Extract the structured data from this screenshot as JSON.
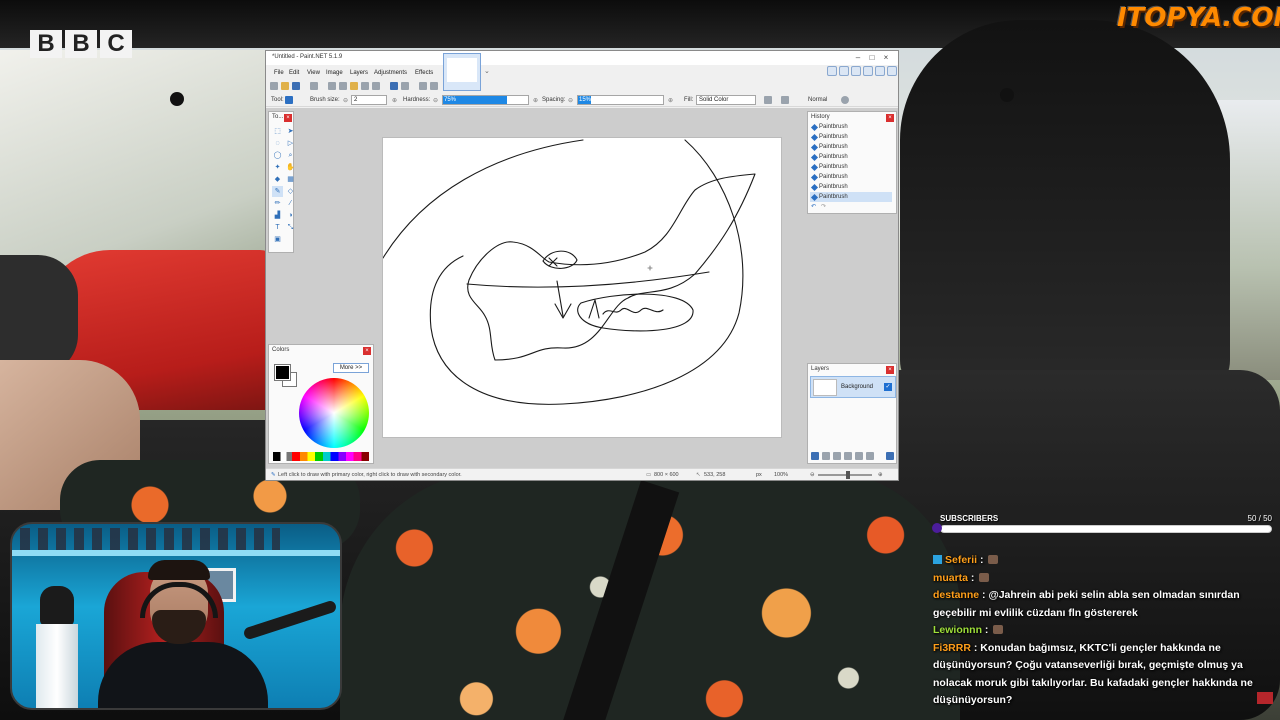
{
  "overlay": {
    "bbc_logo_letters": [
      "B",
      "B",
      "C"
    ],
    "site_logo": "ITOPYA.COM"
  },
  "paint": {
    "title": "*Untitled - Paint.NET 5.1.9",
    "menu": [
      "File",
      "Edit",
      "View",
      "Image",
      "Layers",
      "Adjustments",
      "Effects"
    ],
    "toolbar": {
      "tool_label": "Tool:",
      "brush_size_label": "Brush size:",
      "brush_size_value": "2",
      "hardness_label": "Hardness:",
      "hardness_value": "75%",
      "hardness_fraction": 0.75,
      "spacing_label": "Spacing:",
      "spacing_value": "15%",
      "spacing_fraction": 0.15,
      "fill_label": "Fill:",
      "fill_value": "Solid Color",
      "blend_value": "Normal"
    },
    "tools_panel": {
      "title": "To..."
    },
    "history": {
      "title": "History",
      "items": [
        "Paintbrush",
        "Paintbrush",
        "Paintbrush",
        "Paintbrush",
        "Paintbrush",
        "Paintbrush",
        "Paintbrush",
        "Paintbrush"
      ],
      "selected_index": 7
    },
    "colors": {
      "title": "Colors",
      "more_button": "More >>",
      "primary": "#000000",
      "secondary": "#ffffff"
    },
    "layers": {
      "title": "Layers",
      "items": [
        {
          "name": "Background",
          "visible": true
        }
      ]
    },
    "status": {
      "hint": "Left click to draw with primary color, right click to draw with secondary color.",
      "image_size": "800 × 600",
      "cursor_pos": "533, 258",
      "unit": "px",
      "zoom": "100%"
    },
    "sketch_text": "Aman"
  },
  "stream": {
    "subs_label": "SUBSCRIBERS",
    "subs_count": "50  /  50",
    "subs_fraction": 1.0,
    "chat": [
      {
        "user": "Seferii",
        "color": "#ff9f1a",
        "text": "",
        "badge": true,
        "emote": true
      },
      {
        "user": "muarta",
        "color": "#ff9f1a",
        "text": "",
        "badge": false,
        "emote": true
      },
      {
        "user": "destanne",
        "color": "#ff9f1a",
        "text": "@Jahrein abi peki selin abla sen olmadan sınırdan geçebilir mi evlilik cüzdanı fln göstererek",
        "badge": false,
        "emote": false
      },
      {
        "user": "Lewionnn",
        "color": "#9fe03a",
        "text": "",
        "badge": false,
        "emote": true
      },
      {
        "user": "Fi3RRR",
        "color": "#ff9f1a",
        "text": "Konudan bağımsız, KKTC'li gençler hakkında ne düşünüyorsun? Çoğu vatanseverliği bırak, geçmişte olmuş ya nolacak moruk gibi takılıyorlar. Bu kafadaki gençler hakkında ne düşünüyorsun?",
        "badge": false,
        "emote": false
      }
    ]
  }
}
